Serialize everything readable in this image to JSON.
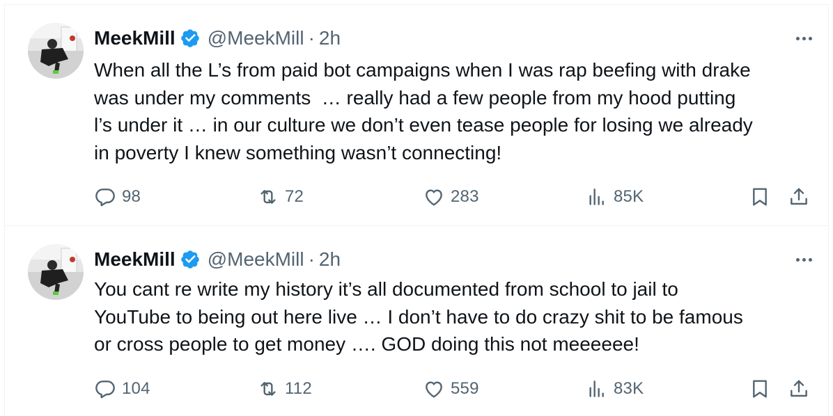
{
  "tweets": [
    {
      "author": {
        "name": "MeekMill",
        "handle": "@MeekMill",
        "separator": "·",
        "time": "2h"
      },
      "text": "When all the L’s from paid bot campaigns when I was rap beefing with drake\nwas under my comments  … really had a few people from my hood putting\nl’s under it … in our culture we don’t even tease people for losing we already\nin poverty I knew something wasn’t connecting!",
      "stats": {
        "replies": "98",
        "reposts": "72",
        "likes": "283",
        "views": "85K"
      }
    },
    {
      "author": {
        "name": "MeekMill",
        "handle": "@MeekMill",
        "separator": "·",
        "time": "2h"
      },
      "text": "You cant re write my history it’s all documented from school to jail to\nYouTube to being out here live … I don’t have to do crazy shit to be famous\nor cross people to get money …. GOD doing this not meeeeee!",
      "stats": {
        "replies": "104",
        "reposts": "112",
        "likes": "559",
        "views": "83K"
      }
    }
  ],
  "icons": {
    "verified": "verified-badge-icon",
    "more": "more-icon",
    "reply": "reply-icon",
    "repost": "repost-icon",
    "like": "like-icon",
    "views": "views-icon",
    "bookmark": "bookmark-icon",
    "share": "share-icon"
  },
  "colors": {
    "text": "#0f1419",
    "secondary": "#536471",
    "verified": "#1d9bf0",
    "border": "#eff3f4"
  }
}
